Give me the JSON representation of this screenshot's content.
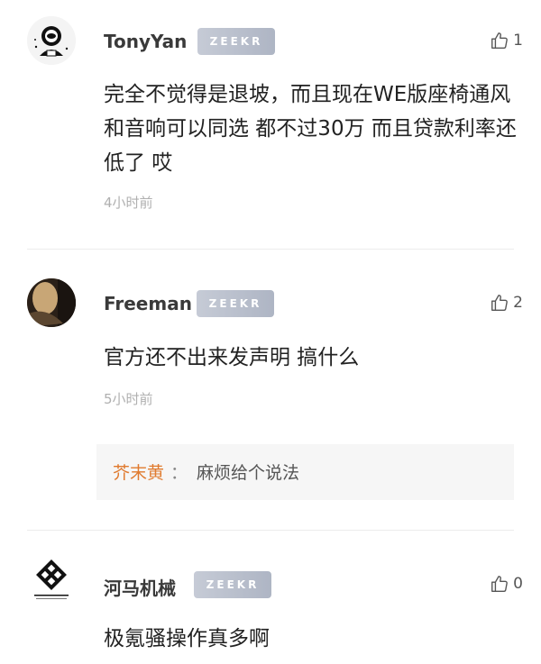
{
  "comments": [
    {
      "username": "TonyYan",
      "badge": "ZEEKR",
      "like_count": "1",
      "content": "完全不觉得是退坡，而且现在WE版座椅通风和音响可以同选 都不过30万 而且贷款利率还低了 哎",
      "time": "4小时前"
    },
    {
      "username": "Freeman",
      "badge": "ZEEKR",
      "like_count": "2",
      "content": "官方还不出来发声明 搞什么",
      "time": "5小时前",
      "reply": {
        "username": "芥末黄",
        "separator": "：",
        "text": "麻烦给个说法"
      }
    },
    {
      "username": "河马机械",
      "badge": "ZEEKR",
      "like_count": "0",
      "content": "极氪骚操作真多啊"
    }
  ],
  "colors": {
    "reply_username": "#e07a2e",
    "badge": "#b8bfcd",
    "time": "#b0b0b0"
  },
  "icons": {
    "like": "thumbs-up-icon"
  }
}
